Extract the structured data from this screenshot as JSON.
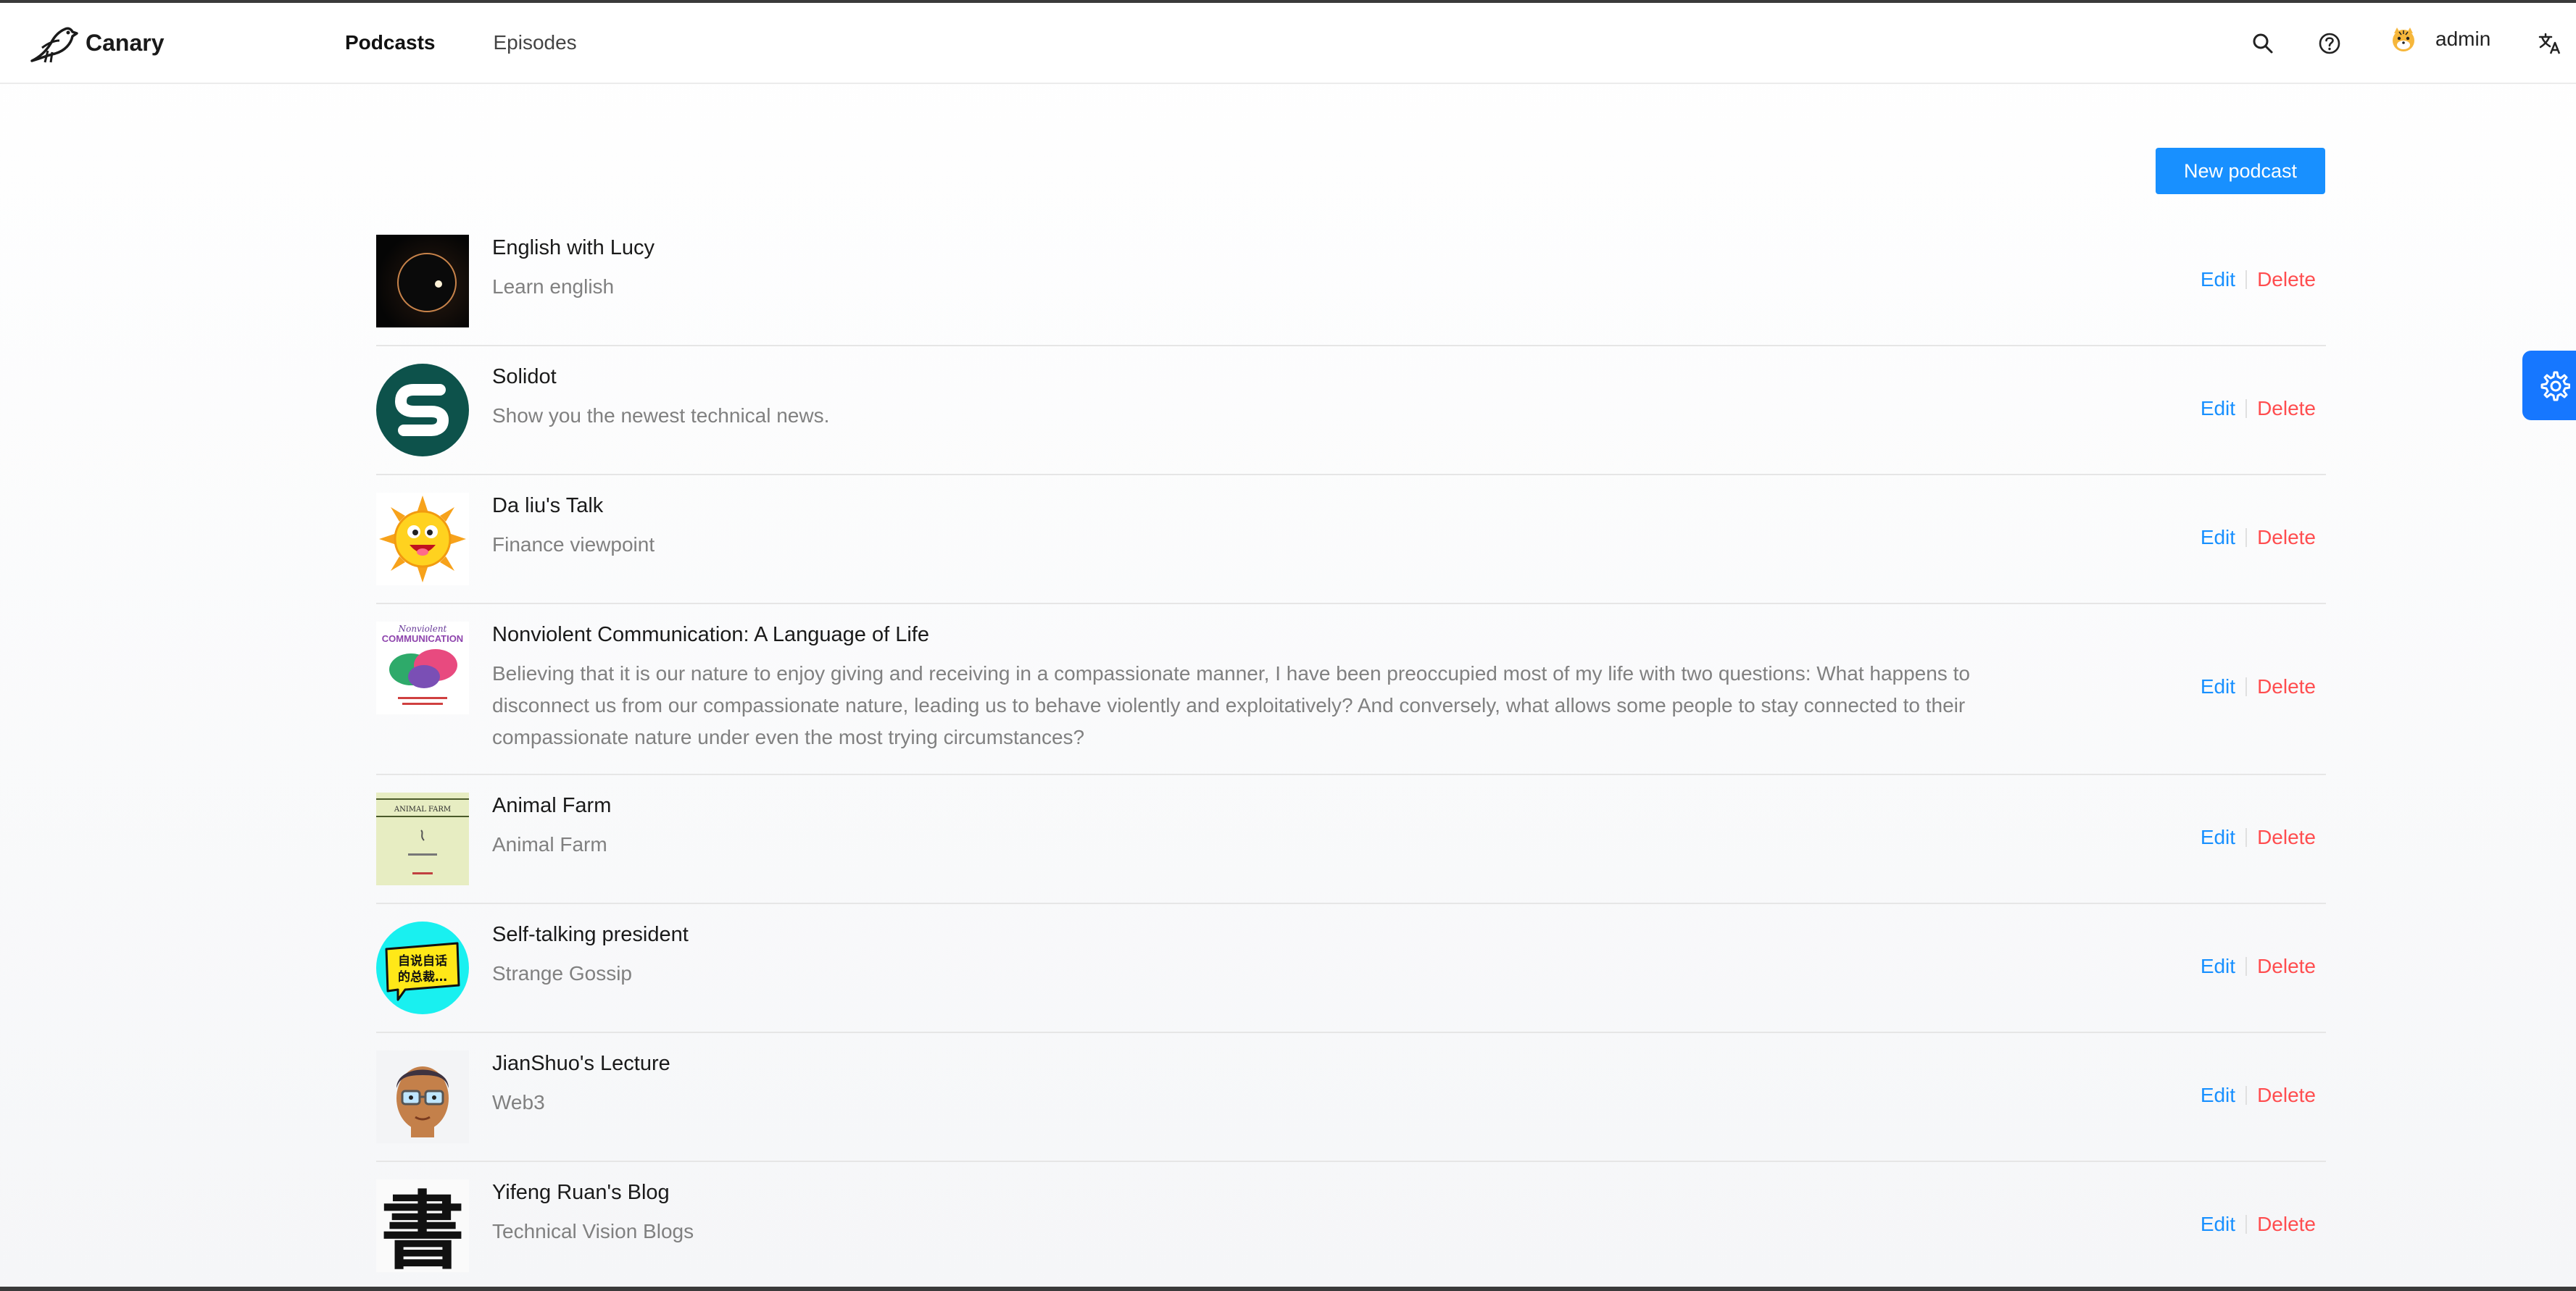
{
  "app": {
    "name": "Canary"
  },
  "nav": {
    "tabs": [
      {
        "label": "Podcasts",
        "active": true
      },
      {
        "label": "Episodes",
        "active": false
      }
    ]
  },
  "header": {
    "user_name": "admin",
    "icons": [
      "search-icon",
      "help-icon",
      "avatar",
      "translate-icon"
    ]
  },
  "toolbar": {
    "new_podcast_label": "New podcast"
  },
  "actions": {
    "edit_label": "Edit",
    "delete_label": "Delete"
  },
  "podcasts": [
    {
      "title": "English with Lucy",
      "description": "Learn english",
      "cover": "eclipse"
    },
    {
      "title": "Solidot",
      "description": "Show you the newest technical news.",
      "cover": "solidot-logo"
    },
    {
      "title": "Da liu's Talk",
      "description": "Finance viewpoint",
      "cover": "cartoon-sun"
    },
    {
      "title": "Nonviolent Communication: A Language of Life",
      "description": "Believing that it is our nature to enjoy giving and receiving in a compassionate manner, I have been preoccupied most of my life with two questions: What happens to disconnect us from our compassionate nature, leading us to behave violently and exploitatively? And conversely, what allows some people to stay connected to their compassionate nature under even the most trying circumstances?",
      "cover": "book-cover-nvc",
      "cover_text": [
        "Nonviolent",
        "COMMUNICATION"
      ]
    },
    {
      "title": "Animal Farm",
      "description": "Animal Farm",
      "cover": "book-cover-animal-farm",
      "cover_text": [
        "ANIMAL FARM"
      ]
    },
    {
      "title": "Self-talking president",
      "description": "Strange Gossip",
      "cover": "speech-bubble",
      "cover_text": [
        "自说自话",
        "的总裁…"
      ]
    },
    {
      "title": "JianShuo's Lecture",
      "description": "Web3",
      "cover": "cartoon-face"
    },
    {
      "title": "Yifeng Ruan's Blog",
      "description": "Technical Vision Blogs",
      "cover": "calligraphy",
      "cover_text": [
        "書"
      ]
    }
  ],
  "colors": {
    "primary": "#1890ff",
    "danger": "#ff4d4f"
  }
}
